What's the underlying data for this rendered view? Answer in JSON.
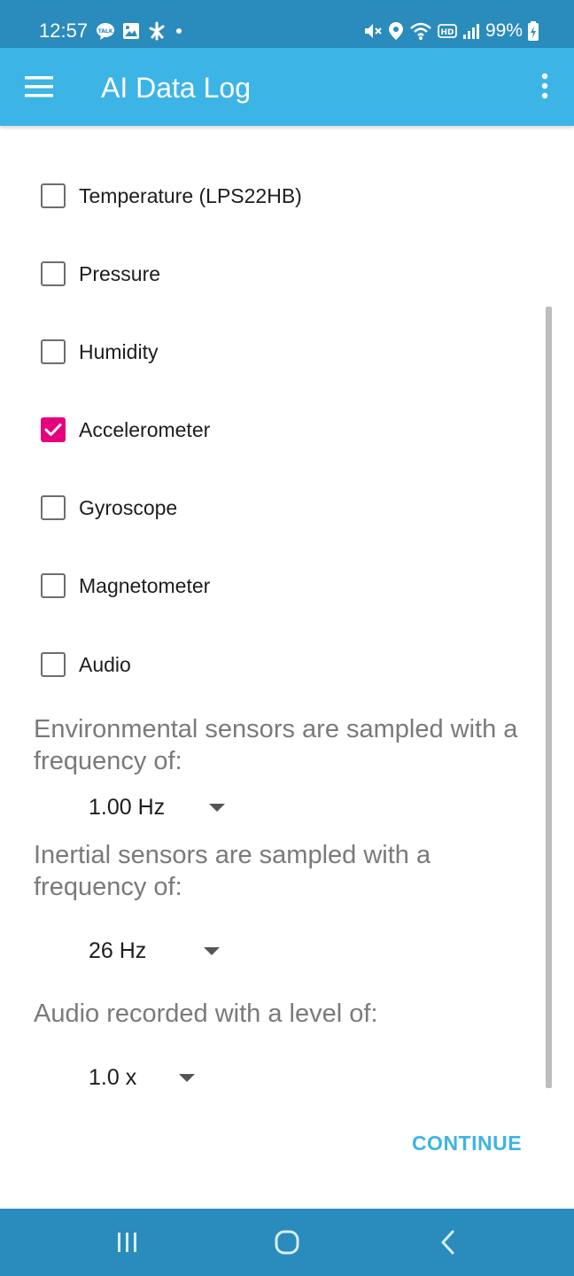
{
  "status_bar": {
    "time": "12:57",
    "battery": "99%",
    "left_icons": [
      "talk-icon",
      "gallery-icon",
      "app-icon",
      "dot-icon"
    ],
    "right_icons": [
      "mute-icon",
      "location-icon",
      "wifi-icon",
      "hd-icon",
      "signal-icon",
      "battery-icon"
    ]
  },
  "app_bar": {
    "title": "AI Data Log",
    "color": "#3db4e6"
  },
  "sensors": [
    {
      "label": "Temperature (LPS22HB)",
      "checked": false
    },
    {
      "label": "Pressure",
      "checked": false
    },
    {
      "label": "Humidity",
      "checked": false
    },
    {
      "label": "Accelerometer",
      "checked": true
    },
    {
      "label": "Gyroscope",
      "checked": false
    },
    {
      "label": "Magnetometer",
      "checked": false
    },
    {
      "label": "Audio",
      "checked": false
    }
  ],
  "environmental": {
    "text": "Environmental sensors are sampled with a frequency of:",
    "value": "1.00 Hz"
  },
  "inertial": {
    "text": "Inertial sensors are sampled with a frequency of:",
    "value": "26 Hz"
  },
  "audio": {
    "text": "Audio recorded with a level of:",
    "value": "1.0 x"
  },
  "continue_label": "CONTINUE",
  "colors": {
    "accent": "#e6007e",
    "primary": "#3db4e6",
    "status_bar": "#2a8bbd"
  }
}
